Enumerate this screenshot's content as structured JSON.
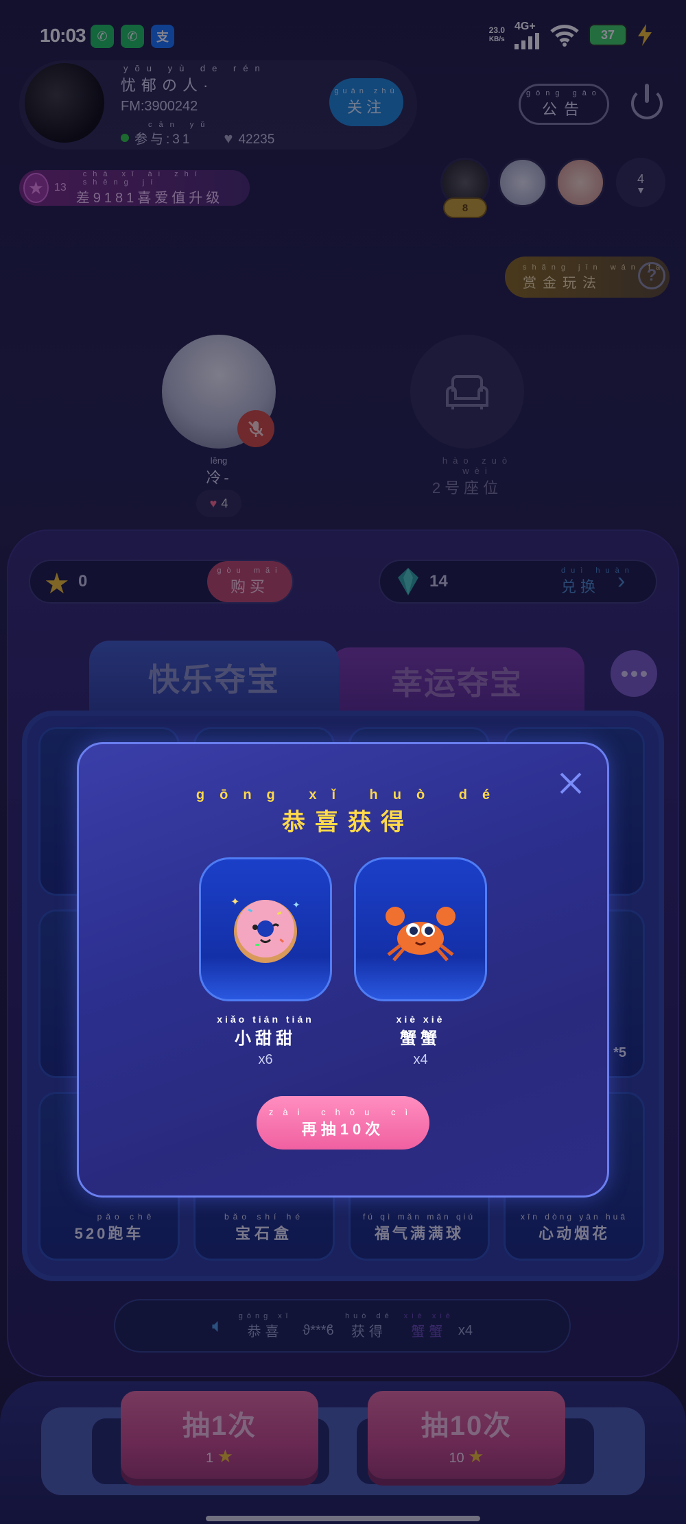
{
  "status_bar": {
    "time": "10:03",
    "speed": "23.0",
    "speed_unit": "KB/s",
    "network": "4G+",
    "battery": "37"
  },
  "host": {
    "name_pinyin": "yōu yù de rén",
    "name": "忧郁の人·",
    "fm": "FM:3900242",
    "participants_pinyin": "cān yǔ",
    "participants_label": "参与:31",
    "likes": "42235"
  },
  "follow_button": {
    "pinyin": "guān zhù",
    "label": "关注"
  },
  "notice_button": {
    "pinyin": "gōng gào",
    "label": "公告"
  },
  "level": {
    "badge": "13",
    "pinyin": "chà xǐ ài zhí shēng jí",
    "text": "差9181喜爱值升级"
  },
  "audience": {
    "badge": "8",
    "count": "4"
  },
  "rules_button": {
    "pinyin": "shǎng jīn wán fǎ",
    "label": "赏金玩法"
  },
  "seats": [
    {
      "name_pinyin": "lěng",
      "name": "冷-",
      "likes": "4"
    },
    {
      "label_pinyin": "hào zuò wèi",
      "label": "2号座位"
    }
  ],
  "wallet": {
    "coins": "0",
    "buy_pinyin": "gòu mǎi",
    "buy_label": "购买",
    "gems": "14",
    "exchange_pinyin": "duì huàn",
    "exchange_label": "兑换"
  },
  "tabs": [
    {
      "label": "快乐夺宝"
    },
    {
      "label": "幸运夺宝"
    }
  ],
  "grid_bottom_labels": [
    {
      "pinyin": "pǎo chē",
      "label": "520跑车"
    },
    {
      "pinyin": "bǎo shí hé",
      "label": "宝石盒"
    },
    {
      "pinyin": "fú qì mǎn mǎn qiú",
      "label": "福气满满球"
    },
    {
      "pinyin": "xīn dòng yān huā",
      "label": "心动烟花"
    }
  ],
  "grid_side_badge": "*5",
  "ticker": {
    "prefix_pinyin": "gōng xǐ",
    "prefix": "恭喜",
    "user": "ϑ***ϐ",
    "verb_pinyin": "huò dé",
    "verb": "获得",
    "item_pinyin": "xiè xiè",
    "item": "蟹蟹",
    "qty": "x4"
  },
  "draw_buttons": [
    {
      "label": "抽1次",
      "cost": "1"
    },
    {
      "label": "抽10次",
      "cost": "10"
    }
  ],
  "modal": {
    "title_pinyin": "gōng xǐ huò dé",
    "title": "恭喜获得",
    "prizes": [
      {
        "name_pinyin": "xiǎo tián tián",
        "name": "小甜甜",
        "count": "x6",
        "icon": "donut-icon"
      },
      {
        "name_pinyin": "xiè xiè",
        "name": "蟹蟹",
        "count": "x4",
        "icon": "crab-icon"
      }
    ],
    "again_pinyin": "zài chōu cì",
    "again_label": "再抽10次"
  }
}
